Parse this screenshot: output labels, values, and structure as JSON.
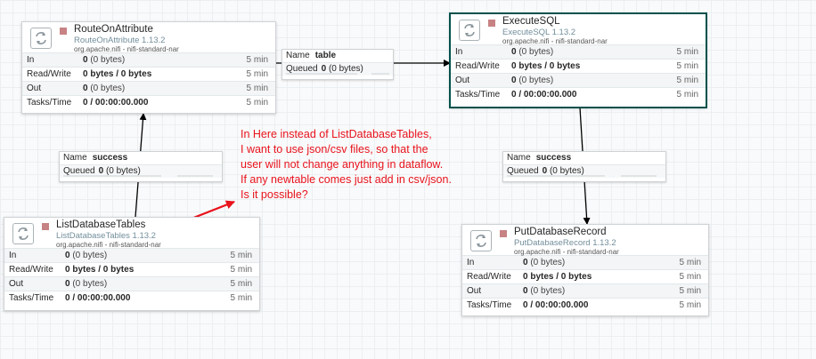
{
  "processors": {
    "route_on_attribute": {
      "name": "RouteOnAttribute",
      "type": "RouteOnAttribute 1.13.2",
      "bundle": "org.apache.nifi - nifi-standard-nar",
      "rows": {
        "in": {
          "label": "In",
          "value": "0",
          "detail": "(0 bytes)",
          "window": "5 min"
        },
        "read_write": {
          "label": "Read/Write",
          "value": "0 bytes / 0 bytes",
          "window": "5 min"
        },
        "out": {
          "label": "Out",
          "value": "0",
          "detail": "(0 bytes)",
          "window": "5 min"
        },
        "tasks_time": {
          "label": "Tasks/Time",
          "value": "0 / 00:00:00.000",
          "window": "5 min"
        }
      }
    },
    "execute_sql": {
      "name": "ExecuteSQL",
      "type": "ExecuteSQL 1.13.2",
      "bundle": "org.apache.nifi - nifi-standard-nar",
      "rows": {
        "in": {
          "label": "In",
          "value": "0",
          "detail": "(0 bytes)",
          "window": "5 min"
        },
        "read_write": {
          "label": "Read/Write",
          "value": "0 bytes / 0 bytes",
          "window": "5 min"
        },
        "out": {
          "label": "Out",
          "value": "0",
          "detail": "(0 bytes)",
          "window": "5 min"
        },
        "tasks_time": {
          "label": "Tasks/Time",
          "value": "0 / 00:00:00.000",
          "window": "5 min"
        }
      }
    },
    "list_database_tables": {
      "name": "ListDatabaseTables",
      "type": "ListDatabaseTables 1.13.2",
      "bundle": "org.apache.nifi - nifi-standard-nar",
      "rows": {
        "in": {
          "label": "In",
          "value": "0",
          "detail": "(0 bytes)",
          "window": "5 min"
        },
        "read_write": {
          "label": "Read/Write",
          "value": "0 bytes / 0 bytes",
          "window": "5 min"
        },
        "out": {
          "label": "Out",
          "value": "0",
          "detail": "(0 bytes)",
          "window": "5 min"
        },
        "tasks_time": {
          "label": "Tasks/Time",
          "value": "0 / 00:00:00.000",
          "window": "5 min"
        }
      }
    },
    "put_database_record": {
      "name": "PutDatabaseRecord",
      "type": "PutDatabaseRecord 1.13.2",
      "bundle": "org.apache.nifi - nifi-standard-nar",
      "rows": {
        "in": {
          "label": "In",
          "value": "0",
          "detail": "(0 bytes)",
          "window": "5 min"
        },
        "read_write": {
          "label": "Read/Write",
          "value": "0 bytes / 0 bytes",
          "window": "5 min"
        },
        "out": {
          "label": "Out",
          "value": "0",
          "detail": "(0 bytes)",
          "window": "5 min"
        },
        "tasks_time": {
          "label": "Tasks/Time",
          "value": "0 / 00:00:00.000",
          "window": "5 min"
        }
      }
    }
  },
  "connections": {
    "table": {
      "name_key": "Name",
      "name": "table",
      "queued_key": "Queued",
      "queued_value": "0",
      "queued_detail": "(0 bytes)"
    },
    "success_left": {
      "name_key": "Name",
      "name": "success",
      "queued_key": "Queued",
      "queued_value": "0",
      "queued_detail": "(0 bytes)"
    },
    "success_right": {
      "name_key": "Name",
      "name": "success",
      "queued_key": "Queued",
      "queued_value": "0",
      "queued_detail": "(0 bytes)"
    }
  },
  "annotation": {
    "lines": [
      "In Here instead of ListDatabaseTables,",
      "I want to use  json/csv files, so that the",
      "user will not change anything in dataflow.",
      "If any newtable comes just add in csv/json.",
      "Is it possible?"
    ]
  },
  "colors": {
    "canvas": "#f9fafb",
    "selected_border": "#00514c",
    "stopped_status": "#c78284",
    "annotation_red": "#e8131c",
    "connection_line": "#000000"
  }
}
